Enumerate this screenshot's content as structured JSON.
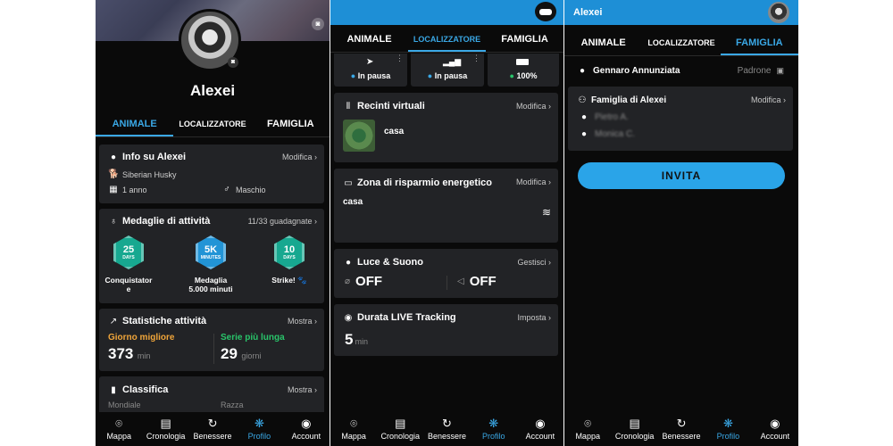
{
  "s1": {
    "name": "Alexei",
    "tabs": [
      "ANIMALE",
      "LOCALIZZATORE",
      "FAMIGLIA"
    ],
    "info": {
      "title": "Info su Alexei",
      "edit": "Modifica",
      "breed": "Siberian Husky",
      "age": "1 anno",
      "sex": "Maschio"
    },
    "medals": {
      "title": "Medaglie di attività",
      "count": "11/33 guadagnate",
      "items": [
        {
          "num": "25",
          "unit": "DAYS",
          "label": "Conquistator\ne",
          "color": "#17a890"
        },
        {
          "num": "5K",
          "unit": "MINUTES",
          "label": "Medaglia\n5.000 minuti",
          "color": "#2294d6"
        },
        {
          "num": "10",
          "unit": "DAYS",
          "label": "Strike! 🐾",
          "color": "#17a890"
        }
      ]
    },
    "stats": {
      "title": "Statistiche attività",
      "link": "Mostra",
      "best_label": "Giorno migliore",
      "best_value": "373",
      "best_unit": "min",
      "streak_label": "Serie più lunga",
      "streak_value": "29",
      "streak_unit": "giorni"
    },
    "rank": {
      "title": "Classifica",
      "link": "Mostra",
      "col1": "Mondiale",
      "col2": "Razza"
    }
  },
  "s2": {
    "tabs": [
      "ANIMALE",
      "LOCALIZZATORE",
      "FAMIGLIA"
    ],
    "status": [
      {
        "label": "In pausa",
        "dot": "#3aa8e6"
      },
      {
        "label": "In pausa",
        "dot": "#3aa8e6"
      },
      {
        "label": "100%",
        "dot": "#29c46a"
      }
    ],
    "fences": {
      "title": "Recinti virtuali",
      "edit": "Modifica",
      "item": "casa"
    },
    "power": {
      "title": "Zona di risparmio energetico",
      "edit": "Modifica",
      "item": "casa"
    },
    "light": {
      "title": "Luce & Suono",
      "manage": "Gestisci",
      "light_state": "OFF",
      "sound_state": "OFF"
    },
    "live": {
      "title": "Durata LIVE Tracking",
      "set": "Imposta",
      "value": "5",
      "unit": "min"
    }
  },
  "s3": {
    "header": "Alexei",
    "tabs": [
      "ANIMALE",
      "LOCALIZZATORE",
      "FAMIGLIA"
    ],
    "owner": {
      "name": "Gennaro Annunziata",
      "role": "Padrone"
    },
    "family": {
      "title": "Famiglia di Alexei",
      "edit": "Modifica",
      "member1": "Pietro A.",
      "member2": "Monica C."
    },
    "invite": "INVITA"
  },
  "nav": [
    "Mappa",
    "Cronologia",
    "Benessere",
    "Profilo",
    "Account"
  ],
  "colors": {
    "accent": "#3aa8e6",
    "best": "#f0a53a",
    "streak": "#29c46a",
    "card": "#222326",
    "invite": "#2aa4e8"
  }
}
